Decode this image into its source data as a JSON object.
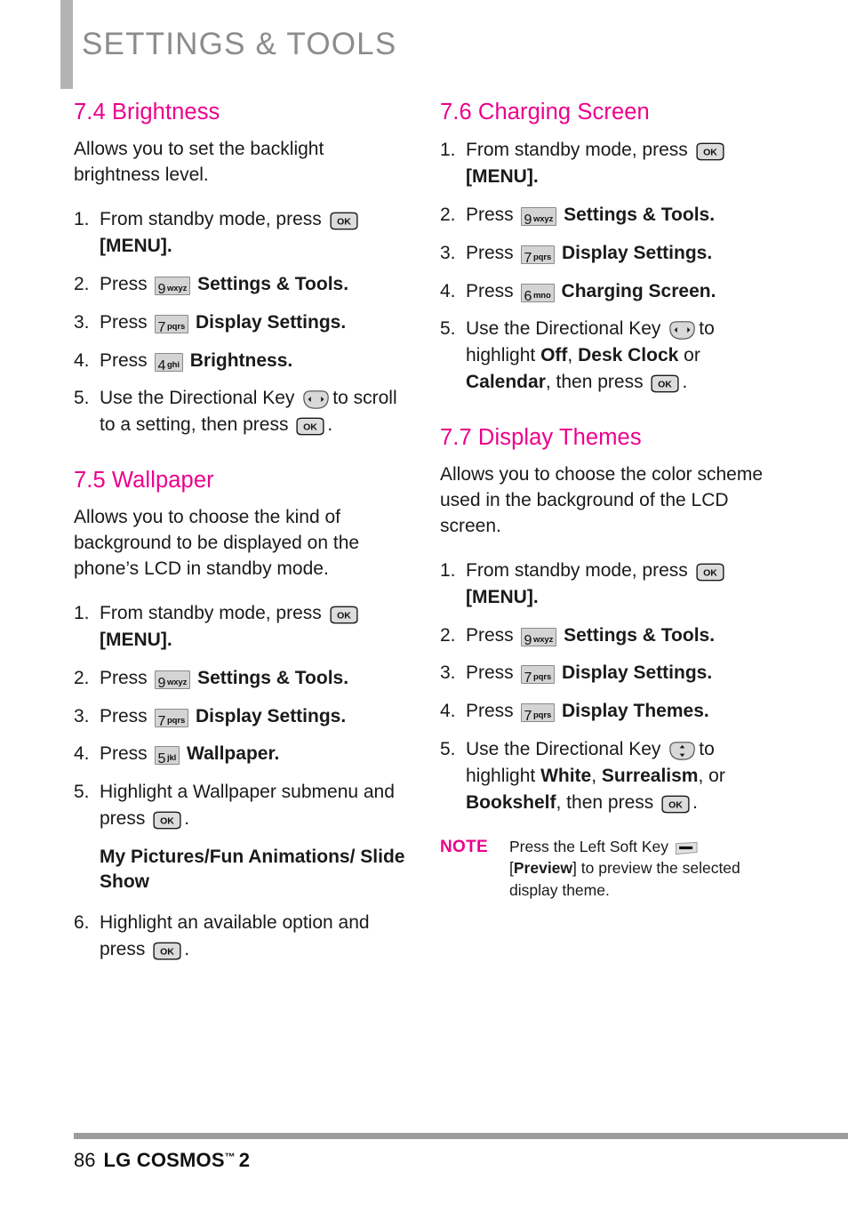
{
  "header": {
    "chapter_title": "SETTINGS & TOOLS"
  },
  "sections": {
    "brightness": {
      "heading": "7.4 Brightness",
      "intro": "Allows you to set the backlight brightness level.",
      "steps": {
        "n1": "1.",
        "s1a": "From standby mode, press",
        "s1b": "[MENU].",
        "n2": "2.",
        "s2a": "Press",
        "s2b": "Settings & Tools.",
        "n3": "3.",
        "s3a": "Press",
        "s3b": "Display Settings.",
        "n4": "4.",
        "s4a": "Press",
        "s4b": "Brightness.",
        "n5": "5.",
        "s5a": "Use the Directional Key",
        "s5b": "to scroll to a setting, then press",
        "s5c": "."
      },
      "keys": {
        "k2": {
          "num": "9",
          "letters": "wxyz"
        },
        "k3": {
          "num": "7",
          "letters": "pqrs"
        },
        "k4": {
          "num": "4",
          "letters": "ghi"
        }
      }
    },
    "wallpaper": {
      "heading": "7.5 Wallpaper",
      "intro": "Allows you to choose the kind of background to be displayed on the phone’s LCD in standby mode.",
      "steps": {
        "n1": "1.",
        "s1a": "From standby mode, press",
        "s1b": "[MENU].",
        "n2": "2.",
        "s2a": "Press",
        "s2b": "Settings & Tools.",
        "n3": "3.",
        "s3a": "Press",
        "s3b": "Display Settings.",
        "n4": "4.",
        "s4a": "Press",
        "s4b": "Wallpaper.",
        "n5": "5.",
        "s5a": "Highlight a Wallpaper submenu and press",
        "s5b": ".",
        "submenu": "My Pictures/Fun Animations/ Slide Show",
        "n6": "6.",
        "s6a": "Highlight an available option and press",
        "s6b": "."
      },
      "keys": {
        "k2": {
          "num": "9",
          "letters": "wxyz"
        },
        "k3": {
          "num": "7",
          "letters": "pqrs"
        },
        "k4": {
          "num": "5",
          "letters": "jkl"
        }
      }
    },
    "charging_screen": {
      "heading": "7.6 Charging Screen",
      "steps": {
        "n1": "1.",
        "s1a": "From standby mode, press",
        "s1b": "[MENU].",
        "n2": "2.",
        "s2a": "Press",
        "s2b": "Settings & Tools.",
        "n3": "3.",
        "s3a": "Press",
        "s3b": "Display Settings.",
        "n4": "4.",
        "s4a": "Press",
        "s4b": "Charging Screen.",
        "n5": "5.",
        "s5a": "Use the Directional Key",
        "s5b": "to highlight",
        "s5opt1": "Off",
        "s5sep1": ",",
        "s5opt2": "Desk Clock",
        "s5sep2": "or",
        "s5opt3": "Calendar",
        "s5c": ", then press",
        "s5d": "."
      },
      "keys": {
        "k2": {
          "num": "9",
          "letters": "wxyz"
        },
        "k3": {
          "num": "7",
          "letters": "pqrs"
        },
        "k4": {
          "num": "6",
          "letters": "mno"
        }
      }
    },
    "display_themes": {
      "heading": "7.7 Display Themes",
      "intro": "Allows you to choose the color scheme used in the background of the LCD screen.",
      "steps": {
        "n1": "1.",
        "s1a": "From standby mode, press",
        "s1b": "[MENU].",
        "n2": "2.",
        "s2a": "Press",
        "s2b": "Settings & Tools.",
        "n3": "3.",
        "s3a": "Press",
        "s3b": "Display Settings.",
        "n4": "4.",
        "s4a": "Press",
        "s4b": "Display Themes.",
        "n5": "5.",
        "s5a": "Use the Directional Key",
        "s5b": "to highlight",
        "s5opt1": "White",
        "s5sep1": ",",
        "s5opt2": "Surrealism",
        "s5sep2": ", or",
        "s5opt3": "Bookshelf",
        "s5c": ", then press",
        "s5d": "."
      },
      "keys": {
        "k2": {
          "num": "9",
          "letters": "wxyz"
        },
        "k3": {
          "num": "7",
          "letters": "pqrs"
        },
        "k4": {
          "num": "7",
          "letters": "pqrs"
        }
      },
      "note": {
        "label": "NOTE",
        "text_a": "Press the Left Soft Key",
        "bracket_open": "[",
        "bold": "Preview",
        "bracket_close": "]",
        "text_b": "to preview the selected display theme."
      }
    }
  },
  "footer": {
    "page_number": "86",
    "book_title": "LG COSMOS",
    "trademark": "™",
    "model": "2"
  },
  "colors": {
    "accent_pink": "#ec008c",
    "header_gray": "#8c8c8c",
    "bar_gray": "#b3b3b3",
    "rule_gray": "#9c9c9c",
    "key_fill": "#d4d4d4"
  }
}
